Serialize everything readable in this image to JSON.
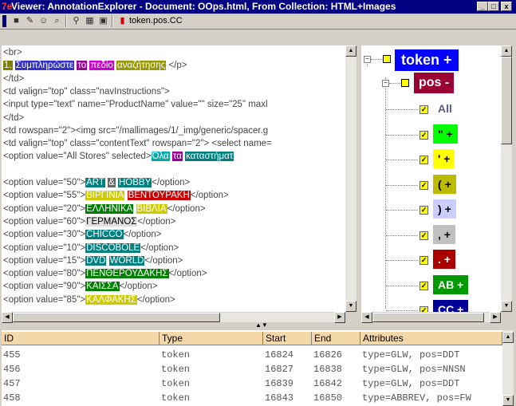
{
  "window": {
    "title": "Viewer: AnnotationExplorer - Document: OOps.html, From Collection: HTML+Images",
    "app_icon": "7e",
    "controls": [
      "_",
      "□",
      "x"
    ]
  },
  "toolbar": {
    "icons": [
      "save-icon",
      "highlight-icon",
      "people-icon",
      "search-icon",
      "find-icon",
      "grid-icon",
      "grid2-icon",
      "annotation-icon"
    ],
    "label": "token.pos.CC"
  },
  "html_view": {
    "lines": [
      {
        "t": "    <br>"
      },
      {
        "segs": [
          {
            "t": "    "
          },
          {
            "t": "1.",
            "c": "#808000",
            "fg": "#fff"
          },
          {
            "t": " "
          },
          {
            "t": "Συμπληρώστε",
            "c": "#3333cc"
          },
          {
            "t": " "
          },
          {
            "t": "το",
            "c": "#990099"
          },
          {
            "t": " "
          },
          {
            "t": "πεδίο",
            "c": "#cc00cc"
          },
          {
            "t": " "
          },
          {
            "t": "αναζήτησης",
            "c": "#999900"
          },
          {
            "t": " </p>"
          }
        ]
      },
      {
        "t": "</td>"
      },
      {
        "t": "<td valign=\"top\" class=\"navInstructions\">"
      },
      {
        "t": "  <input type=\"text\" name=\"ProductName\" value=\"\" size=\"25\" maxl"
      },
      {
        "t": "</td>"
      },
      {
        "t": "<td rowspan=\"2\"><img src=\"/mallimages/1/_img/generic/spacer.g"
      },
      {
        "t": "<td valign=\"top\" class=\"contentText\" rowspan=\"2\"> <select name="
      },
      {
        "segs": [
          {
            "t": "                  <option value=\"All Stores\" selected>"
          },
          {
            "t": "Όλα",
            "c": "#00aaaa"
          },
          {
            "t": " "
          },
          {
            "t": "τα",
            "c": "#990099"
          },
          {
            "t": " "
          },
          {
            "t": "καταστήματ",
            "c": "#008080"
          }
        ]
      },
      {
        "t": ""
      },
      {
        "segs": [
          {
            "t": "  <option value=\"50\">"
          },
          {
            "t": "ART",
            "c": "#008080"
          },
          {
            "t": " "
          },
          {
            "t": "&",
            "c": "#666666"
          },
          {
            "t": " "
          },
          {
            "t": "HOBBY",
            "c": "#008080"
          },
          {
            "t": "</option>"
          }
        ]
      },
      {
        "segs": [
          {
            "t": "  <option value=\"55\">"
          },
          {
            "t": "ΒΙΡΓΙΝΙΑ",
            "c": "#cccc00"
          },
          {
            "t": " "
          },
          {
            "t": "ΒΕΝΤΟΥΡΑΚΗ",
            "c": "#cc0000"
          },
          {
            "t": "</option>"
          }
        ]
      },
      {
        "segs": [
          {
            "t": "  <option value=\"20\">"
          },
          {
            "t": "ΕΛΛΗΝΙΚΑ",
            "c": "#008000"
          },
          {
            "t": " "
          },
          {
            "t": "ΒΙΒΛΙΑ",
            "c": "#cccc00"
          },
          {
            "t": "</option>"
          }
        ]
      },
      {
        "segs": [
          {
            "t": "  <option value=\"60\">"
          },
          {
            "t": "ΓΕΡΜΑΝΟΣ",
            "c": "#e0e0e0",
            "fg": "#000"
          },
          {
            "t": "</option>"
          }
        ]
      },
      {
        "segs": [
          {
            "t": "  <option value=\"30\">"
          },
          {
            "t": "CHICCO",
            "c": "#008080"
          },
          {
            "t": "</option>"
          }
        ]
      },
      {
        "segs": [
          {
            "t": "  <option value=\"10\">"
          },
          {
            "t": "DISCOBOLE",
            "c": "#008080"
          },
          {
            "t": "</option>"
          }
        ]
      },
      {
        "segs": [
          {
            "t": "  <option value=\"15\">"
          },
          {
            "t": "DVD",
            "c": "#008080"
          },
          {
            "t": " "
          },
          {
            "t": "WORLD",
            "c": "#008080"
          },
          {
            "t": "</option>"
          }
        ]
      },
      {
        "segs": [
          {
            "t": "  <option value=\"80\">"
          },
          {
            "t": "ΠΕΝΘΕΡΟΥΔΑΚΗΣ",
            "c": "#008000"
          },
          {
            "t": "</option>"
          }
        ]
      },
      {
        "segs": [
          {
            "t": "  <option value=\"90\">"
          },
          {
            "t": "ΚΑΙΣΣΑ",
            "c": "#008000"
          },
          {
            "t": "</option>"
          }
        ]
      },
      {
        "segs": [
          {
            "t": "  <option value=\"85\">"
          },
          {
            "t": "ΚΑΛΦΑΚΗΣ",
            "c": "#cccc00"
          },
          {
            "t": "</option>"
          }
        ]
      }
    ]
  },
  "tree": {
    "root": {
      "label": "token",
      "suffix": "+",
      "color": "#0000ff"
    },
    "pos": {
      "label": "pos",
      "suffix": "-",
      "color": "#990033"
    },
    "children": [
      {
        "label": "All",
        "suffix": "",
        "color": "#ffffff",
        "fg": "#5a5a8c"
      },
      {
        "label": "\"",
        "suffix": "+",
        "color": "#00ff00",
        "fg": "#000"
      },
      {
        "label": "'",
        "suffix": "+",
        "color": "#ffff00",
        "fg": "#000"
      },
      {
        "label": "(",
        "suffix": "+",
        "color": "#bbbb00",
        "fg": "#000"
      },
      {
        "label": ")",
        "suffix": "+",
        "color": "#ccccff",
        "fg": "#000"
      },
      {
        "label": ",",
        "suffix": "+",
        "color": "#c0c0c0",
        "fg": "#000"
      },
      {
        "label": ".",
        "suffix": "+",
        "color": "#aa0000",
        "fg": "#fff"
      },
      {
        "label": "AB",
        "suffix": "+",
        "color": "#009900",
        "fg": "#fff"
      },
      {
        "label": "CC",
        "suffix": "+",
        "color": "#000099",
        "fg": "#fff"
      }
    ]
  },
  "annotations_table": {
    "columns": [
      "ID",
      "Type",
      "Start",
      "End",
      "Attributes"
    ],
    "rows": [
      [
        "455",
        "token",
        "16824",
        "16826",
        "type=GLW, pos=DDT"
      ],
      [
        "456",
        "token",
        "16827",
        "16838",
        "type=GLW, pos=NNSN"
      ],
      [
        "457",
        "token",
        "16839",
        "16842",
        "type=GLW, pos=DDT"
      ],
      [
        "458",
        "token",
        "16843",
        "16850",
        "type=ABBREV, pos=FW"
      ]
    ]
  }
}
